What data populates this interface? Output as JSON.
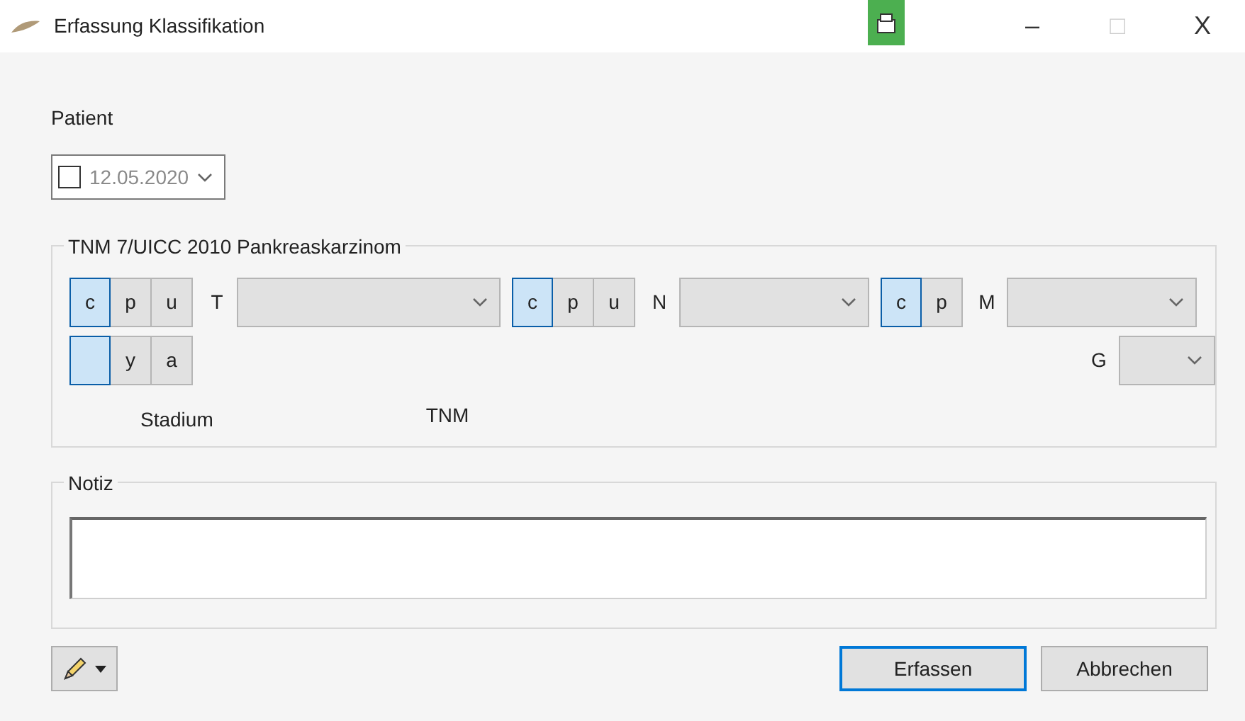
{
  "window": {
    "title": "Erfassung Klassifikation",
    "controls": [
      "–",
      "□",
      "X"
    ]
  },
  "patient": {
    "label": "Patient"
  },
  "date_picker": {
    "value": "12.05.2020",
    "checked": false
  },
  "tnm_group": {
    "title": "TNM 7/UICC 2010 Pankreaskarzinom",
    "rows": [
      {
        "fields": [
          {
            "toggles": [
              {
                "label": "c",
                "selected": true
              },
              {
                "label": "p",
                "selected": false
              },
              {
                "label": "u",
                "selected": false
              }
            ],
            "label": "T"
          },
          {
            "toggles": [
              {
                "label": "c",
                "selected": true
              },
              {
                "label": "p",
                "selected": false
              },
              {
                "label": "u",
                "selected": false
              }
            ],
            "label": "N"
          },
          {
            "toggles": [
              {
                "label": "c",
                "selected": true
              },
              {
                "label": "p",
                "selected": false
              }
            ],
            "label": "M"
          }
        ]
      },
      {
        "fields": [
          {
            "toggles": [
              {
                "selected": true
              },
              {
                "label": "y",
                "selected": false
              },
              {
                "label": "a",
                "selected": false
              }
            ]
          },
          {
            "label": "G"
          }
        ]
      }
    ],
    "stadium_label": "Stadium",
    "tnm_label": "TNM"
  },
  "notiz": {
    "title": "Notiz"
  },
  "buttons": [
    {
      "label": "Erfassen",
      "default": true
    },
    {
      "label": "Abbrechen",
      "default": false
    }
  ]
}
